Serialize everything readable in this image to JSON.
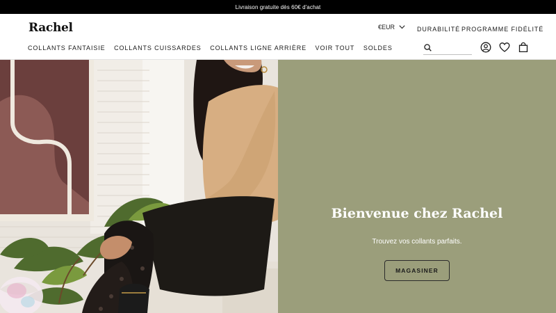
{
  "announcement": "Livraison gratuite dès 60€ d'achat",
  "brand": "Rachel",
  "header": {
    "currency": "€EUR",
    "links": [
      "DURABILITÉ",
      "PROGRAMME FIDÉLITÉ"
    ],
    "search_placeholder": ""
  },
  "nav": [
    "COLLANTS FANTAISIE",
    "COLLANTS CUISSARDES",
    "COLLANTS LIGNE ARRIÈRE",
    "VOIR TOUT",
    "SOLDES"
  ],
  "hero": {
    "title": "Bienvenue chez Rachel",
    "subtitle": "Trouvez vos collants parfaits.",
    "button": "MAGASINER"
  },
  "colors": {
    "announcement_bg": "#000000",
    "hero_panel_bg": "#9b9e7b",
    "hero_text": "#ffffff"
  },
  "icons": [
    "chevron-down-icon",
    "search-icon",
    "account-icon",
    "heart-icon",
    "bag-icon"
  ]
}
